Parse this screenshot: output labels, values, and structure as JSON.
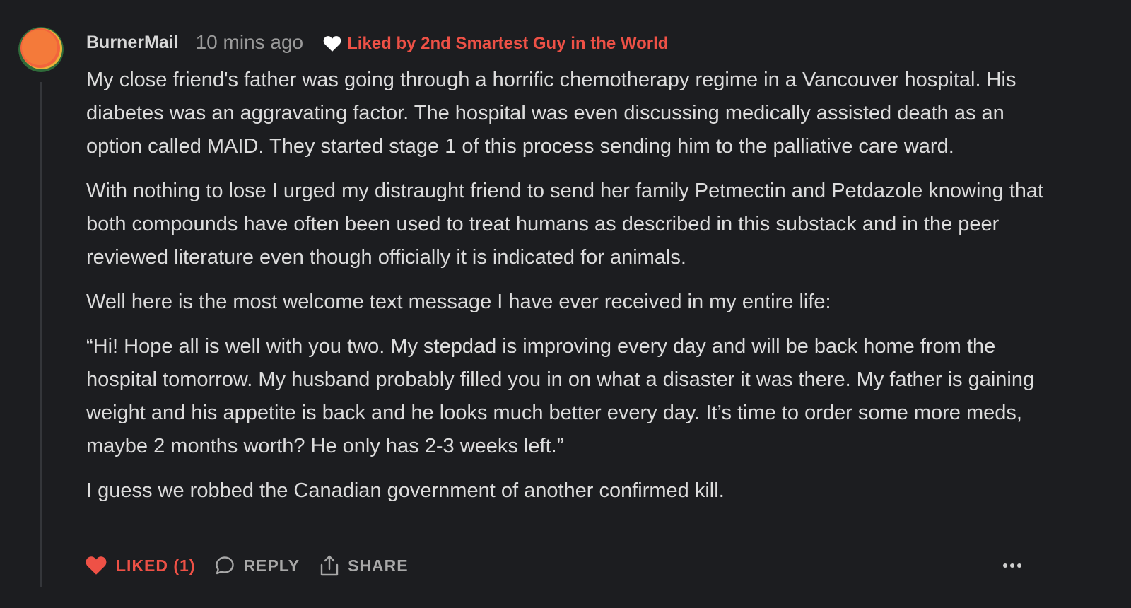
{
  "comment": {
    "author": "BurnerMail",
    "timestamp": "10 mins ago",
    "liked_by": "Liked by 2nd Smartest Guy in the World",
    "paragraphs": [
      "My close friend's father was going through a horrific chemotherapy regime in a Vancouver hospital. His diabetes was an aggravating factor. The hospital was even discussing medically assisted death as an option called MAID. They started stage 1 of this process sending him to the palliative care ward.",
      "With nothing to lose I urged my distraught friend to send her family Petmectin and Petdazole knowing that both compounds have often been used to treat humans as described in this substack and in the peer reviewed literature even though officially it is indicated for animals.",
      "Well here is the most welcome text message I have ever received in my entire life:",
      "“Hi! Hope all is well with you two. My stepdad is improving every day and will be back home from the hospital tomorrow. My husband probably filled you in on what a disaster it was there. My father is gaining weight and his appetite is back and he looks much better every day. It’s time to order some more meds, maybe 2 months worth? He only has 2-3 weeks left.”",
      "I guess we robbed the Canadian government of another confirmed kill."
    ]
  },
  "actions": {
    "liked_label": "LIKED (1)",
    "reply_label": "REPLY",
    "share_label": "SHARE"
  },
  "icons": {
    "avatar": "avatar-orange-circle",
    "liked_by": "heart-icon",
    "like": "heart-filled-icon",
    "reply": "speech-bubble-icon",
    "share": "share-upload-icon",
    "more": "more-dots-icon"
  },
  "colors": {
    "background": "#1c1d20",
    "accent": "#ee5146",
    "text": "#dcdcdc",
    "muted": "#9a9a9a"
  }
}
